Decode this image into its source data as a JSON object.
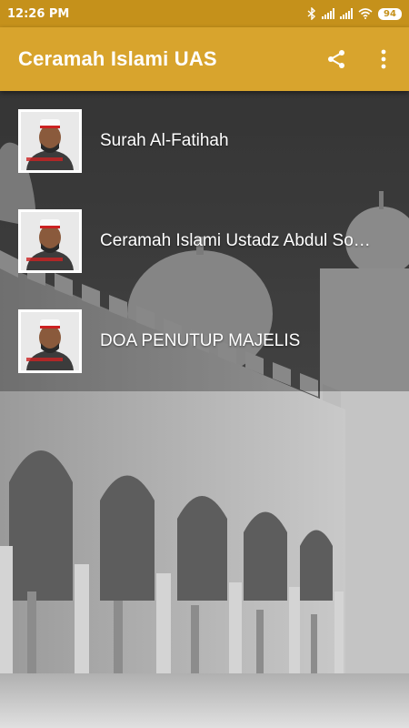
{
  "status_bar": {
    "time": "12:26 PM",
    "battery": "94",
    "icons": [
      "bluetooth-icon",
      "signal-icon",
      "signal-icon",
      "wifi-icon",
      "battery-icon"
    ]
  },
  "app_bar": {
    "title": "Ceramah Islami UAS",
    "actions": [
      "share-icon",
      "more-vert-icon"
    ]
  },
  "list": {
    "items": [
      {
        "label": "Surah Al-Fatihah",
        "thumbnail": "ustadz-portrait"
      },
      {
        "label": "Ceramah Islami Ustadz Abdul Somad",
        "thumbnail": "ustadz-portrait"
      },
      {
        "label": "DOA PENUTUP MAJELIS",
        "thumbnail": "ustadz-portrait"
      }
    ]
  },
  "colors": {
    "status_bar": "#c5911b",
    "app_bar": "#d8a42d",
    "text": "#ffffff"
  }
}
